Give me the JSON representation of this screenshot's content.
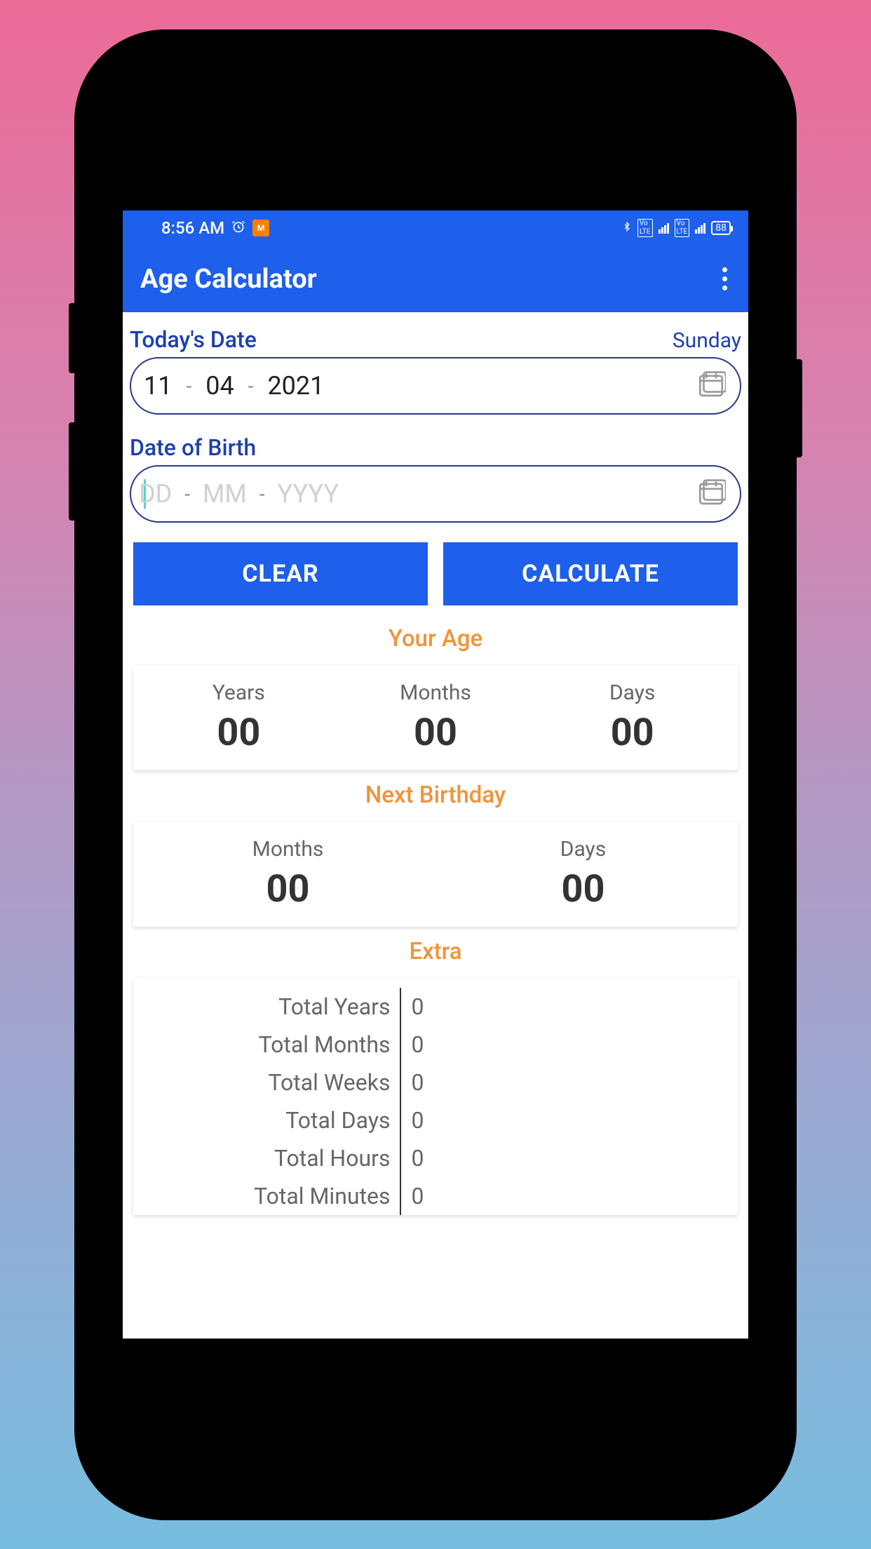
{
  "status": {
    "time": "8:56 AM",
    "battery": "88"
  },
  "app": {
    "title": "Age Calculator"
  },
  "today": {
    "label": "Today's Date",
    "day": "Sunday",
    "dd": "11",
    "mm": "04",
    "yyyy": "2021"
  },
  "dob": {
    "label": "Date of Birth",
    "placeholder_dd": "DD",
    "placeholder_mm": "MM",
    "placeholder_yyyy": "YYYY"
  },
  "buttons": {
    "clear": "CLEAR",
    "calculate": "CALCULATE"
  },
  "age": {
    "title": "Your Age",
    "years_label": "Years",
    "months_label": "Months",
    "days_label": "Days",
    "years": "00",
    "months": "00",
    "days": "00"
  },
  "next_birthday": {
    "title": "Next Birthday",
    "months_label": "Months",
    "days_label": "Days",
    "months": "00",
    "days": "00"
  },
  "extra": {
    "title": "Extra",
    "rows": [
      {
        "label": "Total Years",
        "value": "0"
      },
      {
        "label": "Total Months",
        "value": "0"
      },
      {
        "label": "Total Weeks",
        "value": "0"
      },
      {
        "label": "Total Days",
        "value": "0"
      },
      {
        "label": "Total Hours",
        "value": "0"
      },
      {
        "label": "Total Minutes",
        "value": "0"
      }
    ]
  }
}
